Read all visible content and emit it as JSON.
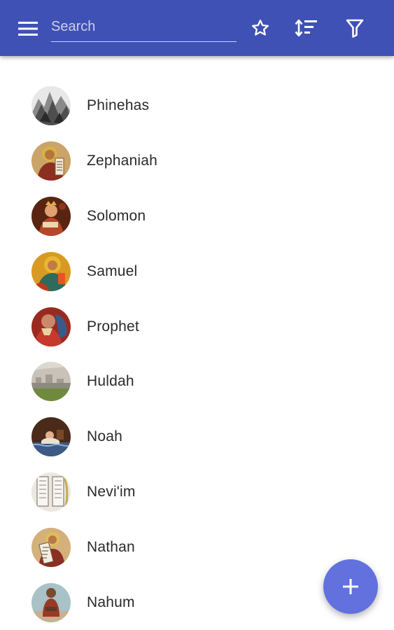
{
  "appbar": {
    "background": "#3f51b5",
    "menu_icon": "menu-icon",
    "search": {
      "placeholder": "Search",
      "value": ""
    },
    "actions": [
      {
        "icon": "star-outline-icon"
      },
      {
        "icon": "sort-icon"
      },
      {
        "icon": "filter-icon"
      }
    ]
  },
  "list": {
    "items": [
      {
        "label": "Phinehas",
        "avatar": "phinehas-avatar"
      },
      {
        "label": "Zephaniah",
        "avatar": "zephaniah-avatar"
      },
      {
        "label": "Solomon",
        "avatar": "solomon-avatar"
      },
      {
        "label": "Samuel",
        "avatar": "samuel-avatar"
      },
      {
        "label": "Prophet",
        "avatar": "prophet-avatar"
      },
      {
        "label": "Huldah",
        "avatar": "huldah-avatar"
      },
      {
        "label": "Noah",
        "avatar": "noah-avatar"
      },
      {
        "label": "Nevi'im",
        "avatar": "neviim-avatar"
      },
      {
        "label": "Nathan",
        "avatar": "nathan-avatar"
      },
      {
        "label": "Nahum",
        "avatar": "nahum-avatar"
      }
    ]
  },
  "fab": {
    "icon": "plus-icon",
    "color": "#6271dd"
  }
}
